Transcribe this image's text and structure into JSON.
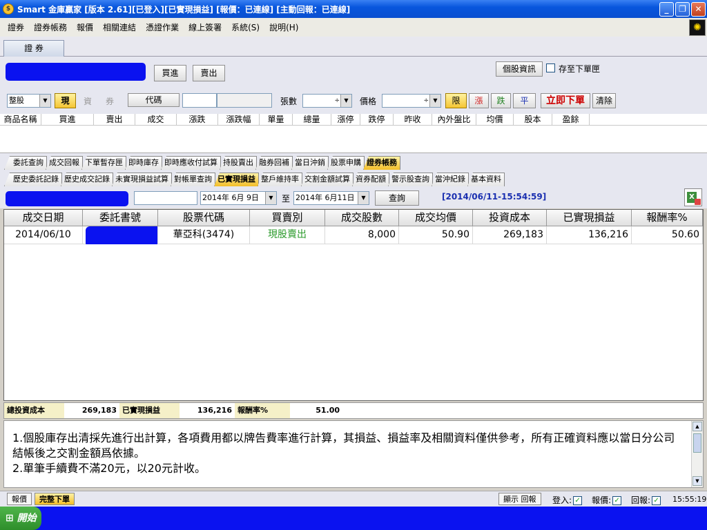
{
  "window": {
    "title": "Smart 金庫贏家 [版本 2.61][已登入][已實現損益] [報價：已連線] [主動回報：已連線]",
    "app_icon": "coin-icon",
    "min_icon": "minimize-icon",
    "max_icon": "restore-icon",
    "close_icon": "close-icon"
  },
  "menu": [
    "證券",
    "證券帳務",
    "報價",
    "相關連結",
    "憑證作業",
    "線上簽署",
    "系統(S)",
    "說明(H)"
  ],
  "main_tab": "證 券",
  "order": {
    "buy": "買進",
    "sell": "賣出",
    "stock_info": "個股資訊",
    "save_to_pending": "存至下單匣",
    "trade_unit": "整股",
    "type_cash": "現",
    "type_margin": "資",
    "type_short": "券",
    "code_button": "代碼",
    "lots_label": "張數",
    "price_label": "價格",
    "limit": "限",
    "up": "漲",
    "down": "跌",
    "flat": "平",
    "submit": "立即下單",
    "clear": "清除"
  },
  "quote_headers": [
    "商品名稱",
    "買進",
    "賣出",
    "成交",
    "漲跌",
    "漲跌幅",
    "單量",
    "總量",
    "漲停",
    "跌停",
    "昨收",
    "內外盤比",
    "均價",
    "股本",
    "盈餘"
  ],
  "tabs_row1": [
    "委託查詢",
    "成交回報",
    "下單暫存匣",
    "即時庫存",
    "即時應收付試算",
    "持股賣出",
    "融券回補",
    "當日沖銷",
    "股票申購",
    "證券帳務"
  ],
  "tabs_row1_active": 9,
  "tabs_row2": [
    "歷史委託記錄",
    "歷史成交記錄",
    "未實現損益試算",
    "對帳單查詢",
    "已實現損益",
    "整戶維持率",
    "交割金額試算",
    "資券配額",
    "警示股查詢",
    "當沖紀錄",
    "基本資料"
  ],
  "tabs_row2_active": 4,
  "query": {
    "date_from": "2014年  6月 9日",
    "to_label": "至",
    "date_to": "2014年  6月11日",
    "query_button": "查詢",
    "timestamp": "[2014/06/11-15:54:59]",
    "export_icon": "excel-export-icon"
  },
  "table": {
    "headers": [
      "成交日期",
      "委託書號",
      "股票代碼",
      "買賣別",
      "成交股數",
      "成交均價",
      "投資成本",
      "已實現損益",
      "報酬率%"
    ],
    "rows": [
      [
        "2014/06/10",
        "",
        "華亞科(3474)",
        "現股賣出",
        "8,000",
        "50.90",
        "269,183",
        "136,216",
        "50.60"
      ]
    ]
  },
  "summary": {
    "cost_label": "總投資成本",
    "cost_value": "269,183",
    "pnl_label": "已實現損益",
    "pnl_value": "136,216",
    "ret_label": "報酬率%",
    "ret_value": "51.00"
  },
  "notes": {
    "line1": "1.個股庫存出清採先進行出計算，各項費用都以牌告費率進行計算，其損益、損益率及相關資料僅供參考，所有正確資料應以當日分公司",
    "line2": "結帳後之交割金額爲依據。",
    "line3": "2.單筆手續費不滿20元，以20元計收。"
  },
  "status": {
    "tab_quote": "報價",
    "tab_order": "完整下單",
    "show_report": "顯示 回報",
    "login": "登入:",
    "quote": "報價:",
    "report": "回報:",
    "time": "15:55:19"
  },
  "taskbar": {
    "start": "開始"
  },
  "colors": {
    "accent_yellow": "#f3be28",
    "sell_green": "#2a9a2a",
    "submit_red": "#cc0000",
    "timestamp_blue": "#1a2fb0",
    "redact_blue": "#0a12f0"
  }
}
